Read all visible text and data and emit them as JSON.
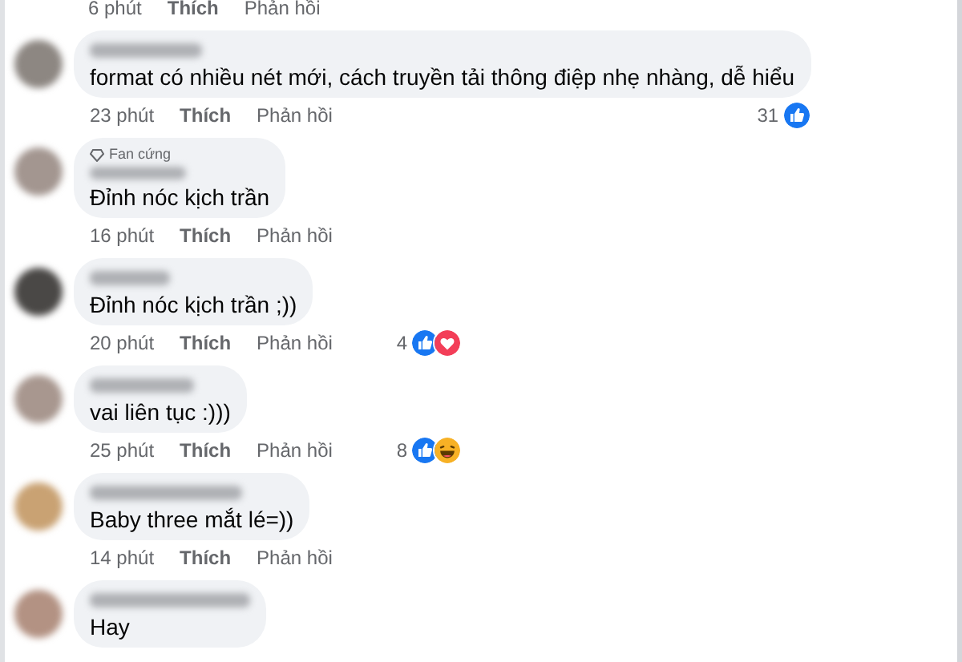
{
  "top_actions": {
    "time": "6 phút",
    "like": "Thích",
    "reply": "Phản hồi"
  },
  "comments": [
    {
      "text": "format có nhiều nét mới, cách truyền tải thông điệp nhẹ nhàng, dễ hiểu",
      "time": "23 phút",
      "like": "Thích",
      "reply": "Phản hồi",
      "reaction_count": "31",
      "reactions": [
        {
          "kind": "like"
        }
      ]
    },
    {
      "fan_label": "Fan cứng",
      "text": "Đỉnh nóc kịch trần",
      "time": "16 phút",
      "like": "Thích",
      "reply": "Phản hồi"
    },
    {
      "text": "Đỉnh nóc kịch trần ;))",
      "time": "20 phút",
      "like": "Thích",
      "reply": "Phản hồi",
      "reaction_count": "4",
      "reactions": [
        {
          "kind": "like"
        },
        {
          "kind": "love"
        }
      ]
    },
    {
      "text": "vai liên tục :)))",
      "time": "25 phút",
      "like": "Thích",
      "reply": "Phản hồi",
      "reaction_count": "8",
      "reactions": [
        {
          "kind": "like"
        },
        {
          "kind": "haha"
        }
      ]
    },
    {
      "text": "Baby three mắt lé=))",
      "time": "14 phút",
      "like": "Thích",
      "reply": "Phản hồi"
    },
    {
      "text": "Hay"
    }
  ]
}
